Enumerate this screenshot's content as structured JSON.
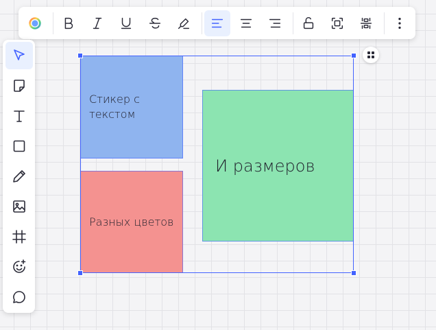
{
  "toolbar": {
    "items": [
      "color-picker",
      "bold",
      "italic",
      "underline",
      "strikethrough",
      "highlight",
      "align-left",
      "align-center",
      "align-right",
      "lock",
      "fit-to-content",
      "distribute",
      "more"
    ]
  },
  "sidebar": {
    "items": [
      "select-tool",
      "sticky-note-tool",
      "text-tool",
      "shape-tool",
      "pen-tool",
      "image-tool",
      "frame-tool",
      "emoji-tool",
      "comment-tool"
    ]
  },
  "stickers": [
    {
      "text": "Стикер с текстом",
      "color": "#8fb4ef"
    },
    {
      "text": "Разных цветов",
      "color": "#f49290"
    },
    {
      "text": "И размеров",
      "color": "#8ce4b1"
    }
  ],
  "colors": {
    "accent": "#4262ff",
    "icon": "#2b2b38"
  }
}
